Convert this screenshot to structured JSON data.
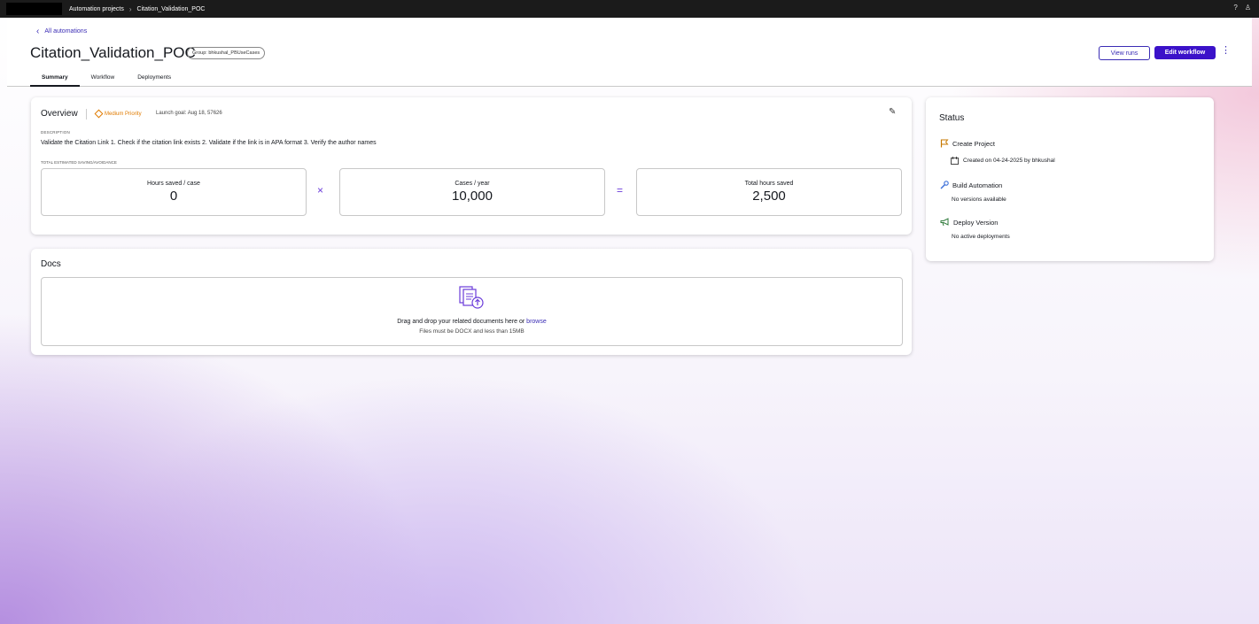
{
  "topbar": {
    "breadcrumb": [
      "Automation projects",
      "Citation_Validation_POC"
    ]
  },
  "header": {
    "back_label": "All automations",
    "title": "Citation_Validation_POC",
    "group_badge": "Group: bhkushal_PBUseCases",
    "view_runs": "View runs",
    "edit_workflow": "Edit workflow",
    "tabs": [
      {
        "label": "Summary",
        "active": true
      },
      {
        "label": "Workflow",
        "active": false
      },
      {
        "label": "Deployments",
        "active": false
      }
    ]
  },
  "overview": {
    "title": "Overview",
    "priority": "Medium Priority",
    "launch_goal": "Launch goal: Aug 18, 57626",
    "description_label": "DESCRIPTION",
    "description": "Validate the Citation Link 1. Check if the citation link exists 2. Validate if the link is in APA format 3. Verify the author names",
    "total_label": "TOTAL ESTIMATED SAVING/AVOIDANCE",
    "metrics": [
      {
        "label": "Hours saved / case",
        "value": "0"
      },
      {
        "label": "Cases / year",
        "value": "10,000"
      },
      {
        "label": "Total hours saved",
        "value": "2,500"
      }
    ],
    "ops": [
      "×",
      "="
    ]
  },
  "docs": {
    "title": "Docs",
    "drop_text": "Drag and drop your related documents here or ",
    "browse": "browse",
    "sub_text": "Files must be DOCX and less than 15MB"
  },
  "status": {
    "title": "Status",
    "items": [
      {
        "label": "Create Project",
        "sub": "Created on 04-24-2025 by bhkushal",
        "icon": "flag-icon"
      },
      {
        "label": "Build Automation",
        "sub": "No versions available",
        "icon": "wrench-icon"
      },
      {
        "label": "Deploy Version",
        "sub": "No active deployments",
        "icon": "megaphone-icon"
      }
    ]
  },
  "colors": {
    "accent": "#3b12c9",
    "priority": "#e07b00",
    "status_icon": "#c77800"
  }
}
